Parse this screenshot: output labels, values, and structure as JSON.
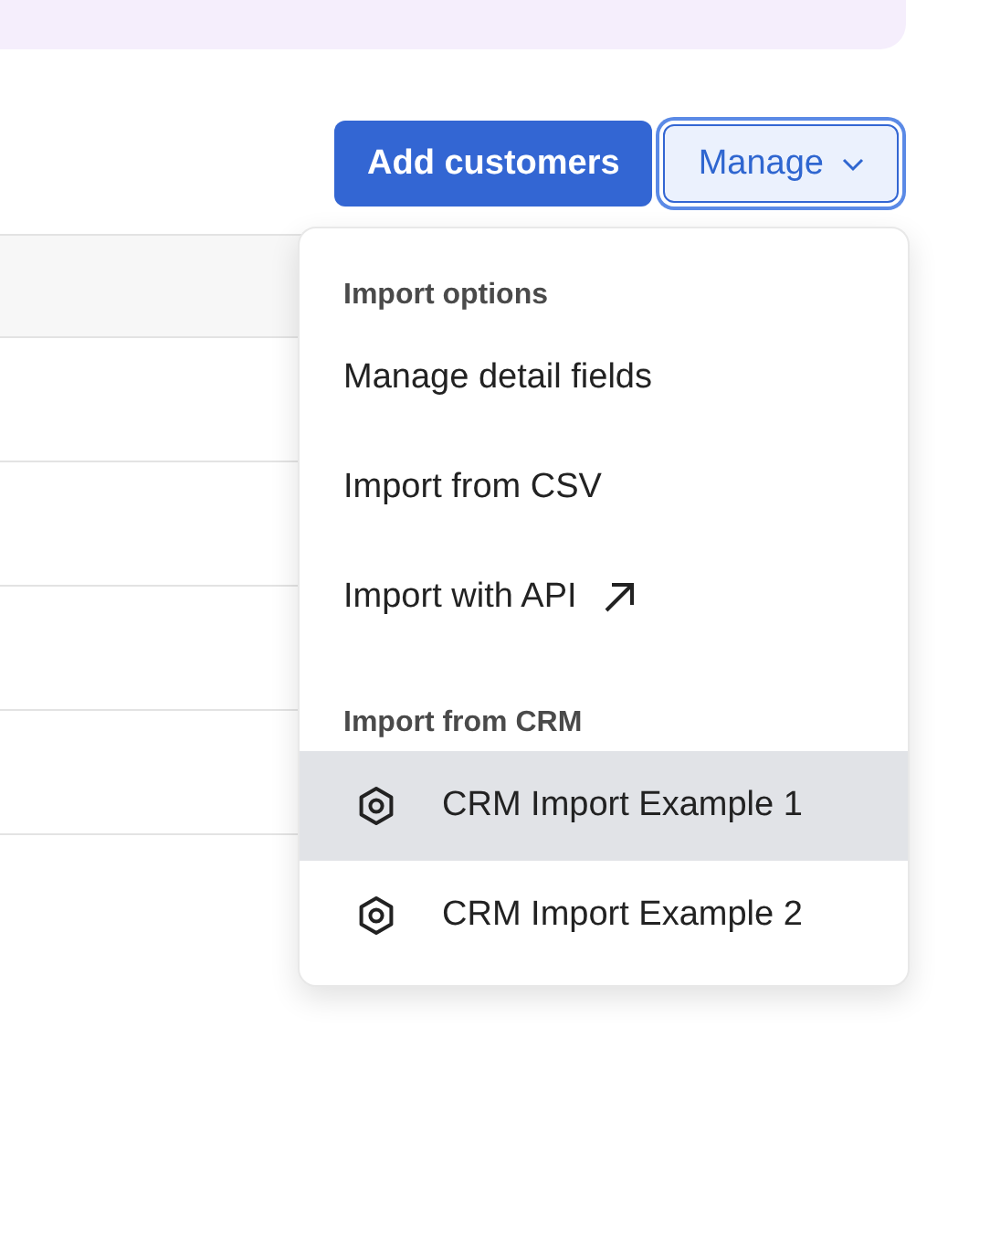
{
  "actions": {
    "add_button": "Add customers",
    "manage_button": {
      "label": "Manage",
      "expanded": true
    }
  },
  "menu": {
    "sections": [
      {
        "heading": "Import options",
        "items": [
          {
            "label": "Manage detail fields",
            "kind": "plain",
            "selected": false
          },
          {
            "label": "Import from CSV",
            "kind": "plain",
            "selected": false
          },
          {
            "label": "Import with API",
            "kind": "external",
            "selected": false
          }
        ]
      },
      {
        "heading": "Import from CRM",
        "items": [
          {
            "label": "CRM Import Example 1",
            "kind": "crm",
            "selected": true
          },
          {
            "label": "CRM Import Example 2",
            "kind": "crm",
            "selected": false
          }
        ]
      }
    ]
  }
}
